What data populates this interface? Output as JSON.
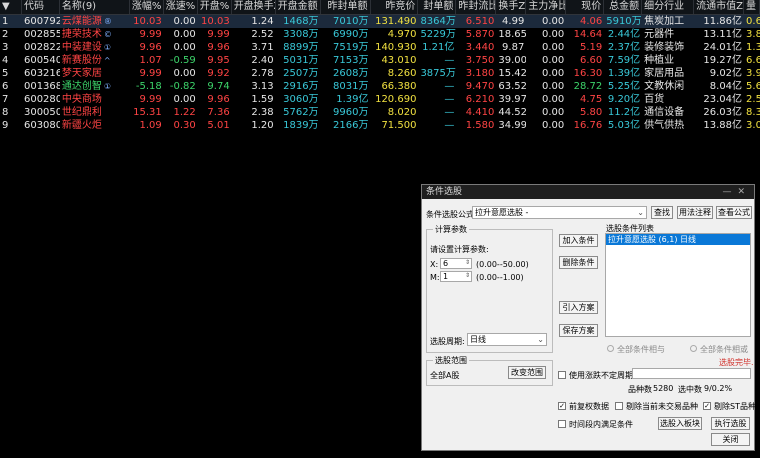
{
  "columns": [
    "▼",
    "代码",
    "名称(9)",
    "涨幅%",
    "涨速%",
    "开盘%",
    "开盘换手Z",
    "开盘金额",
    "昨封单额",
    "昨竞价",
    "封单额",
    "昨封流比",
    "换手Z",
    "主力净比%",
    "现价",
    "总金额",
    "细分行业",
    "流通市值Z",
    "量"
  ],
  "rows": [
    [
      "1",
      "600792",
      "云煤能源",
      "10.03",
      "0.00",
      "10.03",
      "1.24",
      "1468万",
      "7010万",
      "131.490",
      "8364万",
      "6.510",
      "4.99",
      "0.00",
      "4.06",
      "5910万",
      "焦炭加工",
      "11.86亿",
      "0.6"
    ],
    [
      "2",
      "002855",
      "捷荣技术",
      "9.99",
      "0.00",
      "9.99",
      "2.52",
      "3308万",
      "6990万",
      "4.970",
      "5229万",
      "5.870",
      "18.65",
      "0.00",
      "14.64",
      "2.44亿",
      "元器件",
      "13.11亿",
      "3.8"
    ],
    [
      "3",
      "002822",
      "中装建设",
      "9.96",
      "0.00",
      "9.96",
      "3.71",
      "8899万",
      "7519万",
      "140.930",
      "1.21亿",
      "3.440",
      "9.87",
      "0.00",
      "5.19",
      "2.37亿",
      "装修装饰",
      "24.01亿",
      "1.3"
    ],
    [
      "4",
      "600540",
      "新赛股份",
      "1.07",
      "-0.59",
      "9.95",
      "2.40",
      "5031万",
      "7153万",
      "43.010",
      "—",
      "3.750",
      "39.00",
      "0.00",
      "6.60",
      "7.59亿",
      "种植业",
      "19.27亿",
      "6.6"
    ],
    [
      "5",
      "603216",
      "梦天家居",
      "9.99",
      "0.00",
      "9.92",
      "2.78",
      "2507万",
      "2608万",
      "8.260",
      "3875万",
      "3.180",
      "15.42",
      "0.00",
      "16.30",
      "1.39亿",
      "家居用品",
      "9.02亿",
      "3.9"
    ],
    [
      "6",
      "001368",
      "通达创智",
      "-5.18",
      "-0.82",
      "9.74",
      "3.13",
      "2916万",
      "8031万",
      "66.380",
      "—",
      "9.470",
      "63.52",
      "0.00",
      "28.72",
      "5.25亿",
      "文教休闲",
      "8.04亿",
      "5.6"
    ],
    [
      "7",
      "600280",
      "中央商场",
      "9.99",
      "0.00",
      "9.96",
      "1.59",
      "3060万",
      "1.39亿",
      "120.690",
      "—",
      "6.210",
      "39.97",
      "0.00",
      "4.75",
      "9.20亿",
      "百货",
      "23.04亿",
      "2.5"
    ],
    [
      "8",
      "300050",
      "世纪鼎利",
      "15.31",
      "1.22",
      "7.36",
      "2.38",
      "5762万",
      "9960万",
      "8.020",
      "—",
      "4.410",
      "44.52",
      "0.00",
      "5.80",
      "11.2亿",
      "通信设备",
      "26.03亿",
      "8.3"
    ],
    [
      "9",
      "603080",
      "新疆火炬",
      "1.09",
      "0.30",
      "5.01",
      "1.20",
      "1839万",
      "2166万",
      "71.500",
      "—",
      "1.580",
      "34.99",
      "0.00",
      "16.76",
      "5.03亿",
      "供气供热",
      "13.88亿",
      "3.0"
    ]
  ],
  "name_marks": [
    "®",
    "©",
    "①",
    "^",
    "",
    "①",
    "",
    "",
    ""
  ],
  "dialog": {
    "title": "条件选股",
    "formula_label": "条件选股公式",
    "formula_value": "拉升意愿选股 -",
    "btn_query": "查找",
    "btn_usage": "用法注释",
    "btn_view": "查看公式",
    "calc_group": "计算参数",
    "calc_hint": "请设置计算参数:",
    "param_x_label": "X:",
    "param_x_value": "6",
    "param_x_range": "(0.00--50.00)",
    "param_y_label": "M:",
    "param_y_value": "1",
    "param_y_range": "(0.00--1.00)",
    "btn_add": "加入条件",
    "btn_del": "删除条件",
    "btn_import": "引入方案",
    "btn_save": "保存方案",
    "list_label": "选股条件列表",
    "list_item": "拉升意愿选股 (6,1) 日线",
    "period_label": "选股周期:",
    "period_value": "日线",
    "radio_and": "全部条件相与",
    "radio_or": "全部条件相或",
    "status": "选股完毕.",
    "range_group": "选股范围",
    "range_value": "全部A股",
    "btn_range": "改变范围",
    "chk_uncertain": "使用涨跌不定周期",
    "count_label": "品种数",
    "count_value": "5280",
    "hit_label": "选中数",
    "hit_value": "9/0.2%",
    "chk_fuquan": "前复权数据",
    "chk_notrade": "剔除当前未交易品种",
    "chk_st": "剔除ST品种",
    "chk_period": "时间段内满足条件",
    "btn_into_block": "选股入板块",
    "btn_exec": "执行选股",
    "btn_close": "关闭"
  },
  "colors": {
    "up": "#ff4444",
    "down": "#3cd36a",
    "flat": "#e6e6e6",
    "amount": "#39c8d8",
    "vol": "#f0e040",
    "accent": "#0a78d7"
  }
}
